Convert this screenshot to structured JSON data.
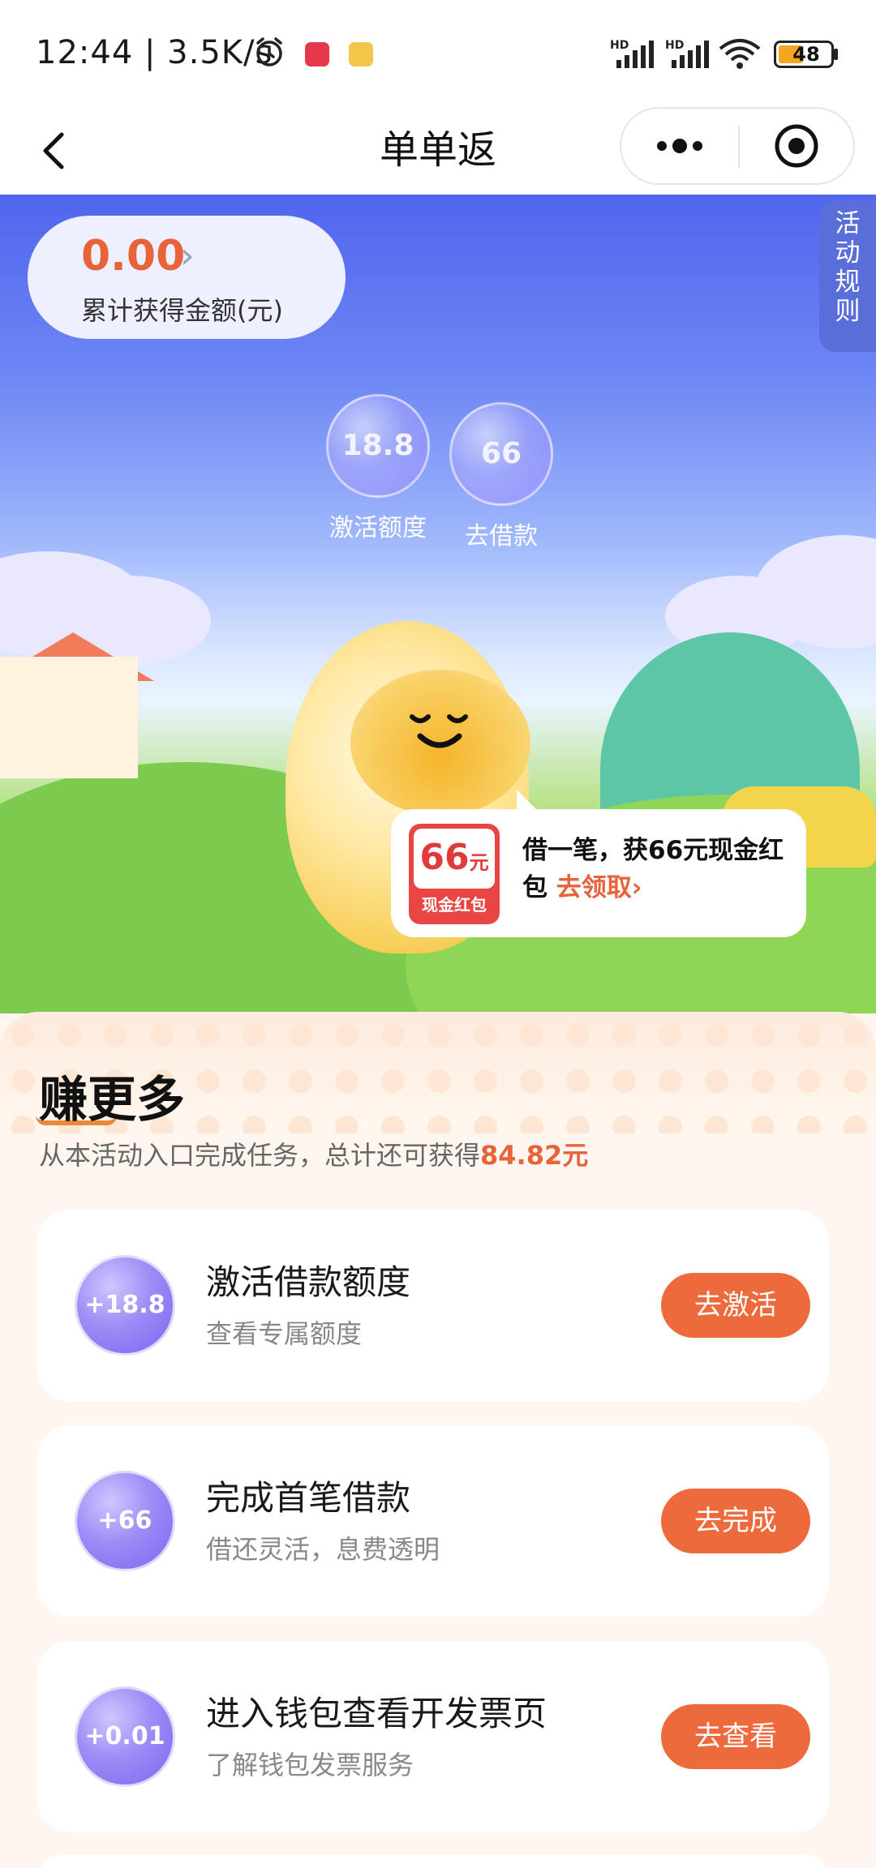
{
  "status_bar": {
    "time": "12:44 | 3.5K/s",
    "battery": "48",
    "signal_label": "HD"
  },
  "nav": {
    "title": "单单返"
  },
  "hero": {
    "amount_value": "0.00",
    "amount_label": "累计获得金额(元)",
    "rules_label": "活动规则",
    "bubbles": [
      {
        "value": "18.8",
        "label": "激活额度"
      },
      {
        "value": "66",
        "label": "去借款"
      }
    ],
    "promo": {
      "coupon_amount": "66",
      "coupon_unit": "元",
      "coupon_label": "现金红包",
      "text": "借一笔，获66元现金红包",
      "link": "去领取›"
    }
  },
  "earn": {
    "title": "赚更多",
    "subtitle_prefix": "从本活动入口完成任务，总计还可获得",
    "subtitle_amount": "84.82元",
    "tasks": [
      {
        "bubble": "+18.8",
        "title": "激活借款额度",
        "desc": "查看专属额度",
        "button": "去激活"
      },
      {
        "bubble": "+66",
        "title": "完成首笔借款",
        "desc": "借还灵活，息费透明",
        "button": "去完成"
      },
      {
        "bubble": "+0.01",
        "title": "进入钱包查看开发票页",
        "desc": "了解钱包发票服务",
        "button": "去查看"
      }
    ]
  },
  "colors": {
    "accent_orange": "#ec6a3c",
    "amount_orange": "#e8623a",
    "hero_blue": "#4f66ee"
  }
}
